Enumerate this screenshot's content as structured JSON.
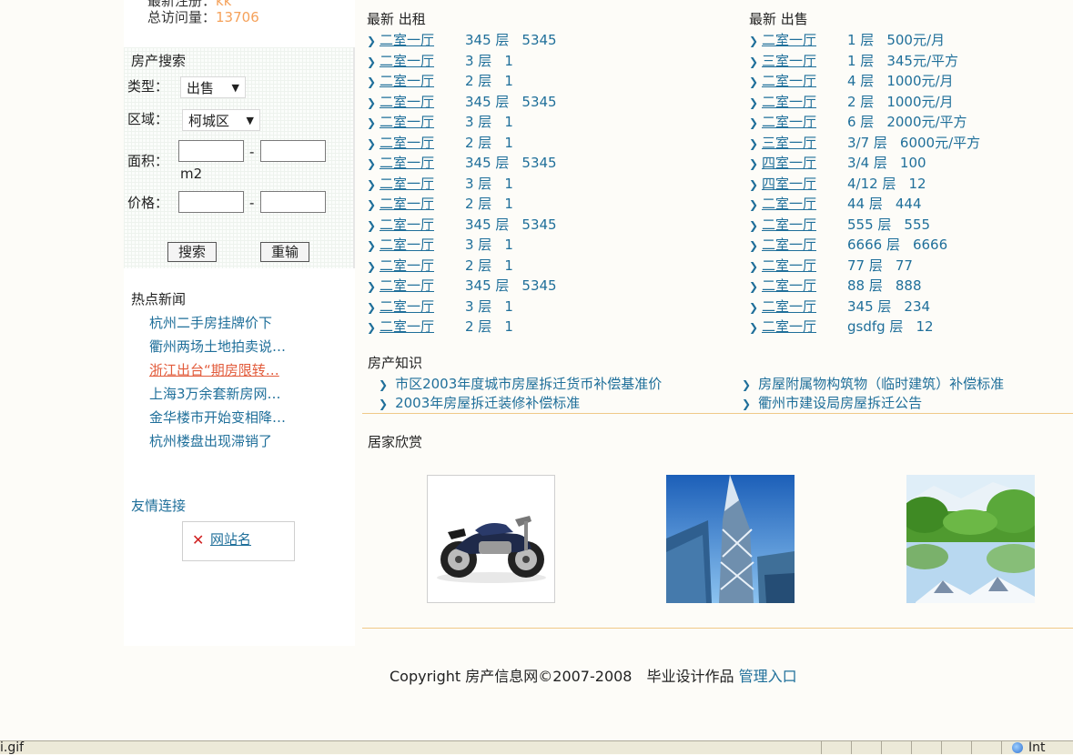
{
  "stats": {
    "new_label": "最新注册：",
    "new_value": "kk",
    "visits_label": "总访问量：",
    "visits_value": "13706"
  },
  "search": {
    "title": "房产搜索",
    "type_label": "类型：",
    "type_value": "出售",
    "district_label": "区域：",
    "district_value": "柯城区",
    "area_label": "面积：",
    "area_unit": "m2",
    "price_label": "价格：",
    "dash": "-",
    "search_button": "搜索",
    "reset_button": "重输"
  },
  "news": {
    "title": "热点新闻",
    "items": [
      "杭州二手房挂牌价下",
      "衢州两场土地拍卖说…",
      "浙江出台“期房限转…",
      "上海3万余套新房网…",
      "金华楼市开始变相降…",
      "杭州楼盘出现滞销了"
    ]
  },
  "links": {
    "title": "友情连接",
    "site_name": "网站名"
  },
  "rent": {
    "title": "最新 出租",
    "items": [
      {
        "type": "二室一厅",
        "floor": "345 层",
        "price": "5345"
      },
      {
        "type": "二室一厅",
        "floor": "3 层",
        "price": "1"
      },
      {
        "type": "二室一厅",
        "floor": "2 层",
        "price": "1"
      },
      {
        "type": "二室一厅",
        "floor": "345 层",
        "price": "5345"
      },
      {
        "type": "二室一厅",
        "floor": "3 层",
        "price": "1"
      },
      {
        "type": "二室一厅",
        "floor": "2 层",
        "price": "1"
      },
      {
        "type": "二室一厅",
        "floor": "345 层",
        "price": "5345"
      },
      {
        "type": "二室一厅",
        "floor": "3 层",
        "price": "1"
      },
      {
        "type": "二室一厅",
        "floor": "2 层",
        "price": "1"
      },
      {
        "type": "二室一厅",
        "floor": "345 层",
        "price": "5345"
      },
      {
        "type": "二室一厅",
        "floor": "3 层",
        "price": "1"
      },
      {
        "type": "二室一厅",
        "floor": "2 层",
        "price": "1"
      },
      {
        "type": "二室一厅",
        "floor": "345 层",
        "price": "5345"
      },
      {
        "type": "二室一厅",
        "floor": "3 层",
        "price": "1"
      },
      {
        "type": "二室一厅",
        "floor": "2 层",
        "price": "1"
      }
    ]
  },
  "sale": {
    "title": "最新 出售",
    "items": [
      {
        "type": "二室一厅",
        "floor": "1 层",
        "price": "500元/月"
      },
      {
        "type": "三室一厅",
        "floor": "1 层",
        "price": "345元/平方"
      },
      {
        "type": "二室一厅",
        "floor": "4 层",
        "price": "1000元/月"
      },
      {
        "type": "二室一厅",
        "floor": "2 层",
        "price": "1000元/月"
      },
      {
        "type": "二室一厅",
        "floor": "6 层",
        "price": "2000元/平方"
      },
      {
        "type": "三室一厅",
        "floor": "3/7 层",
        "price": "6000元/平方"
      },
      {
        "type": "四室一厅",
        "floor": "3/4 层",
        "price": "100"
      },
      {
        "type": "四室一厅",
        "floor": "4/12 层",
        "price": "12"
      },
      {
        "type": "二室一厅",
        "floor": "44 层",
        "price": "444"
      },
      {
        "type": "二室一厅",
        "floor": "555 层",
        "price": "555"
      },
      {
        "type": "二室一厅",
        "floor": "6666 层",
        "price": "6666"
      },
      {
        "type": "二室一厅",
        "floor": "77 层",
        "price": "77"
      },
      {
        "type": "二室一厅",
        "floor": "88 层",
        "price": "888"
      },
      {
        "type": "二室一厅",
        "floor": "345 层",
        "price": "234"
      },
      {
        "type": "二室一厅",
        "floor": "gsdfg 层",
        "price": "12"
      }
    ]
  },
  "knowledge": {
    "title": "房产知识",
    "items": [
      "市区2003年度城市房屋拆迁货币补偿基准价",
      "2003年房屋拆迁装修补偿标准",
      "房屋附属物构筑物（临时建筑）补偿标准",
      "衢州市建设局房屋拆迁公告"
    ]
  },
  "gallery": {
    "title": "居家欣赏"
  },
  "footer": {
    "text": "Copyright 房产信息网©2007-2008　毕业设计作品 ",
    "admin_link": "管理入口"
  },
  "statusbar": {
    "text": "i.gif",
    "zone": "Int"
  },
  "colors": {
    "link": "#1f6f9a",
    "accent_orange": "#f5a15a",
    "hot_news": "#e25b3b",
    "divider": "#f0c988"
  }
}
